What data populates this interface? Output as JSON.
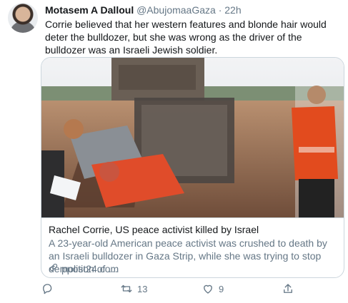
{
  "tweet": {
    "author_name": "Motasem A Dalloul",
    "handle": "@AbujomaaGaza",
    "separator": "·",
    "time": "22h",
    "text": "Corrie believed that her western features and blonde hair would deter the bulldozer, but she was wrong as the driver of the bulldozer was an Israeli Jewish soldier."
  },
  "card": {
    "title": "Rachel Corrie, US peace activist killed by Israel",
    "description": "A 23-year-old American peace activist was crushed to death by an Israeli bulldozer in Gaza Strip, while she was trying to stop demolition of …",
    "domain": "ppost24.com"
  },
  "actions": {
    "reply_count": "",
    "retweet_count": "13",
    "like_count": "9"
  },
  "icons": [
    "reply-icon",
    "retweet-icon",
    "like-icon",
    "share-icon",
    "link-icon"
  ],
  "colors": {
    "text_primary": "#14171a",
    "text_secondary": "#657786",
    "border": "#ccd6dd"
  }
}
